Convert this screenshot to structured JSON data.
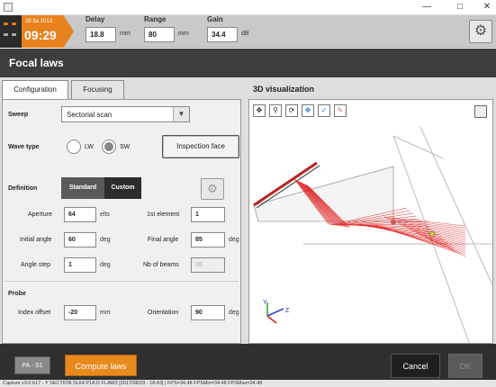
{
  "window": {
    "title": "",
    "controls": [
      "minimize-icon",
      "maximize-icon",
      "close-icon"
    ]
  },
  "topbar": {
    "date": "28 Ita 2013",
    "time": "09:29",
    "delay_label": "Delay",
    "delay_value": "18.8",
    "delay_unit": "mm",
    "range_label": "Range",
    "range_value": "80",
    "range_unit": "mm",
    "gain_label": "Gain",
    "gain_value": "34.4",
    "gain_unit": "dB",
    "settings_icon": "gear-icon"
  },
  "header": {
    "title": "Focal laws"
  },
  "tabs": [
    {
      "label": "Configuration",
      "active": true
    },
    {
      "label": "Focusing",
      "active": false
    }
  ],
  "config": {
    "sweep_label": "Sweep",
    "sweep_value": "Sectorial scan",
    "wave_type_label": "Wave type",
    "wave_lw": "LW",
    "wave_sw": "SW",
    "wave_selected": "SW",
    "inspection_face_button": "Inspection face",
    "definition_label": "Definition",
    "definition_standard": "Standard",
    "definition_custom": "Custom",
    "aperture_label": "Aperture",
    "aperture_value": "64",
    "aperture_unit": "elts",
    "first_element_label": "1st element",
    "first_element_value": "1",
    "initial_angle_label": "Initial angle",
    "initial_angle_value": "60",
    "initial_angle_unit": "deg",
    "final_angle_label": "Final angle",
    "final_angle_value": "85",
    "final_angle_unit": "deg",
    "angle_step_label": "Angle step",
    "angle_step_value": "1",
    "angle_step_unit": "deg",
    "nb_beams_label": "Nb of beams",
    "nb_beams_value": "26",
    "probe_label": "Probe",
    "index_offset_label": "Index offset",
    "index_offset_value": "-20",
    "index_offset_unit": "mm",
    "orientation_label": "Orientation",
    "orientation_value": "90",
    "orientation_unit": "deg"
  },
  "viz": {
    "title": "3D visualization",
    "tools": [
      "fit-icon",
      "zoom-icon",
      "rotate-icon",
      "pan-icon",
      "select-icon",
      "erase-icon"
    ],
    "axes": {
      "y": "Y",
      "z": "Z"
    }
  },
  "footer": {
    "pa_label": "PA - S1",
    "compute_label": "Compute laws",
    "cancel_label": "Cancel",
    "ok_label": "OK"
  },
  "status": {
    "text": "Capture v3.0 b17 - Y SECTION SL64 P1A D FLAW3 [2017/08/29 - 18:43] | FPS=34.48 FPSMin=34.48 FPSMax=34.48"
  },
  "colors": {
    "accent_orange": "#e8821e",
    "header_dark": "#3d3d3d",
    "beam_red": "#e02020"
  }
}
